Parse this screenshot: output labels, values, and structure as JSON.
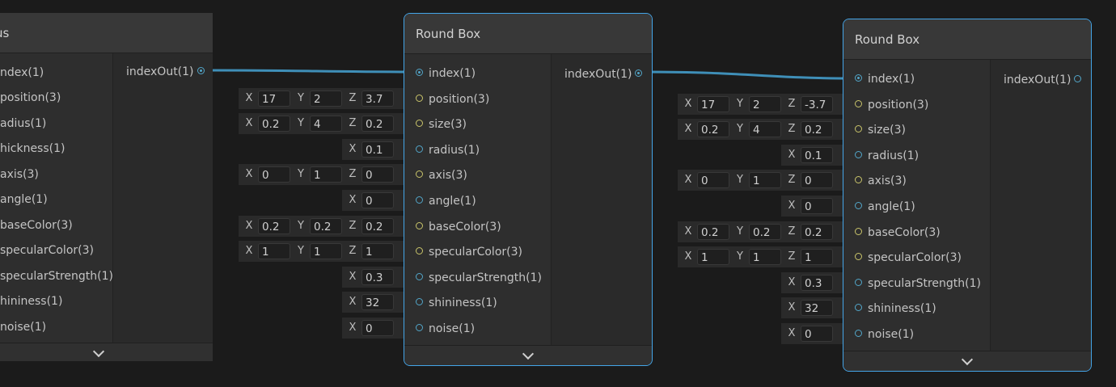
{
  "left_node": {
    "title": "us",
    "inputs": [
      "ndex(1)",
      "position(3)",
      "adius(1)",
      "hickness(1)",
      "axis(3)",
      "angle(1)",
      "baseColor(3)",
      "specularColor(3)",
      "specularStrength(1)",
      "hininess(1)",
      "noise(1)"
    ],
    "output": "indexOut(1)"
  },
  "node1": {
    "title": "Round Box",
    "inputs": [
      "index(1)",
      "position(3)",
      "size(3)",
      "radius(1)",
      "axis(3)",
      "angle(1)",
      "baseColor(3)",
      "specularColor(3)",
      "specularStrength(1)",
      "shininess(1)",
      "noise(1)"
    ],
    "output": "indexOut(1)",
    "fields": {
      "position": [
        "17",
        "2",
        "3.7"
      ],
      "size": [
        "0.2",
        "4",
        "0.2"
      ],
      "radius": "0.1",
      "axis": [
        "0",
        "1",
        "0"
      ],
      "angle": "0",
      "baseColor": [
        "0.2",
        "0.2",
        "0.2"
      ],
      "specularColor": [
        "1",
        "1",
        "1"
      ],
      "specularStrength": "0.3",
      "shininess": "32",
      "noise": "0"
    }
  },
  "node2": {
    "title": "Round Box",
    "inputs": [
      "index(1)",
      "position(3)",
      "size(3)",
      "radius(1)",
      "axis(3)",
      "angle(1)",
      "baseColor(3)",
      "specularColor(3)",
      "specularStrength(1)",
      "shininess(1)",
      "noise(1)"
    ],
    "output": "indexOut(1)",
    "fields": {
      "position": [
        "17",
        "2",
        "-3.7"
      ],
      "size": [
        "0.2",
        "4",
        "0.2"
      ],
      "radius": "0.1",
      "axis": [
        "0",
        "1",
        "0"
      ],
      "angle": "0",
      "baseColor": [
        "0.2",
        "0.2",
        "0.2"
      ],
      "specularColor": [
        "1",
        "1",
        "1"
      ],
      "specularStrength": "0.3",
      "shininess": "32",
      "noise": "0"
    }
  },
  "axis_labels": {
    "x": "X",
    "y": "Y",
    "z": "Z"
  },
  "colors": {
    "background": "#1b1b1b",
    "selection": "#44a5e8",
    "wire": "#3f8fb8",
    "scalar_port": "#52a6c9",
    "vector_port": "#c9c46a"
  }
}
